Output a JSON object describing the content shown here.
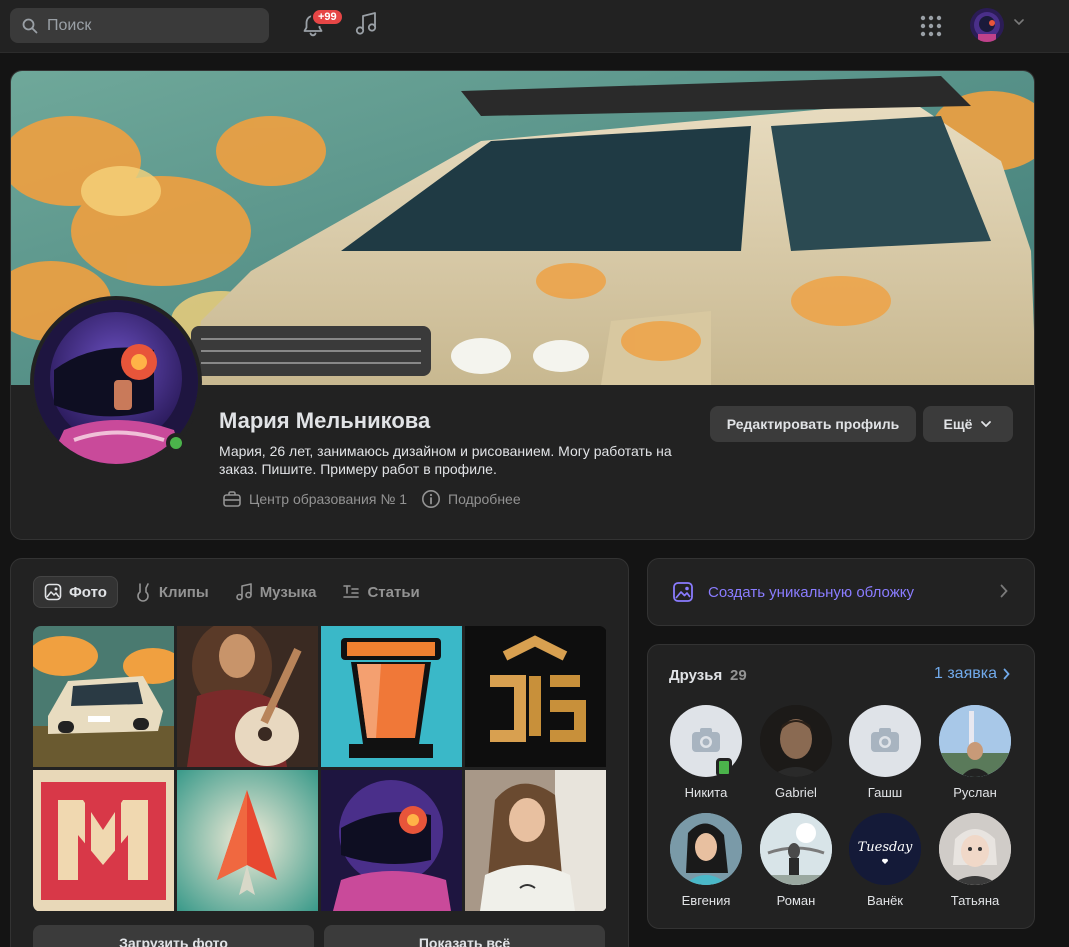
{
  "topbar": {
    "search_placeholder": "Поиск",
    "notifications_badge": "+99"
  },
  "profile": {
    "name": "Мария Мельникова",
    "status": "Мария, 26 лет, занимаюсь дизайном и рисованием. Могу работать на заказ. Пишите. Примеру работ в профиле.",
    "education": "Центр образования № 1",
    "details": "Подробнее",
    "edit_button": "Редактировать профиль",
    "more_button": "Ещё",
    "online": true
  },
  "media": {
    "tabs": [
      {
        "label": "Фото",
        "icon": "image-icon",
        "active": true
      },
      {
        "label": "Клипы",
        "icon": "clips-icon",
        "active": false
      },
      {
        "label": "Музыка",
        "icon": "music-icon",
        "active": false
      },
      {
        "label": "Статьи",
        "icon": "articles-icon",
        "active": false
      }
    ],
    "upload_button": "Загрузить фото",
    "show_all_button": "Показать всё"
  },
  "promo": {
    "label": "Создать уникальную обложку"
  },
  "friends": {
    "title": "Друзья",
    "count": "29",
    "requests_link": "1 заявка",
    "items": [
      {
        "name": "Никита",
        "avatar": "camera-placeholder",
        "mobile_online": true
      },
      {
        "name": "Gabriel",
        "avatar": "photo"
      },
      {
        "name": "Гашш",
        "avatar": "camera-placeholder"
      },
      {
        "name": "Руслан",
        "avatar": "photo"
      },
      {
        "name": "Евгения",
        "avatar": "photo"
      },
      {
        "name": "Роман",
        "avatar": "photo"
      },
      {
        "name": "Ванёк",
        "avatar": "photo",
        "avatar_text": "Tuesday"
      },
      {
        "name": "Татьяна",
        "avatar": "photo"
      }
    ]
  },
  "colors": {
    "background": "#141414",
    "card": "#222222",
    "accent_link": "#71aaeb",
    "promo_purple": "#8a7cff",
    "online_green": "#4bb34b",
    "badge_red": "#e64646"
  }
}
